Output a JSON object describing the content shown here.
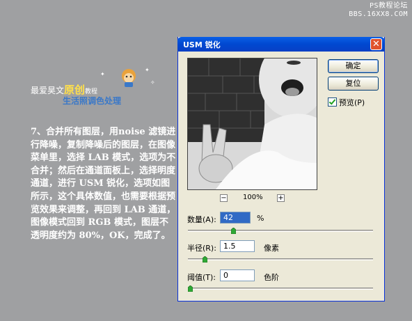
{
  "watermark": {
    "line1": "PS教程论坛",
    "line2": "BBS.16XX8.COM"
  },
  "banner": {
    "prefix": "最爱昊文",
    "highlight": "原创",
    "suffix": "教程",
    "subtitle": "生活照调色处理"
  },
  "article": {
    "text": "7、合并所有图层，用noise 滤镜进行降噪，复制降噪后的图层，在图像菜单里，选择 LAB 模式，选项为不合并；然后在通道面板上，选择明度通道，进行 USM 锐化，选项如图所示，这个具体数值，也需要根据预览效果来调整，再回到 LAB 通道，图像模式回到 RGB 模式，图层不透明度约为 80%，OK，完成了。"
  },
  "dialog": {
    "title": "USM 锐化",
    "ok_label": "确定",
    "reset_label": "复位",
    "preview_label": "预览(P)",
    "zoom_value": "100%",
    "zoom_out_label": "−",
    "zoom_in_label": "+",
    "amount": {
      "label": "数量(A):",
      "value": "42",
      "unit": "%",
      "slider_fraction": 0.24
    },
    "radius": {
      "label": "半径(R):",
      "value": "1.5",
      "unit": "像素",
      "slider_fraction": 0.08
    },
    "threshold": {
      "label": "阈值(T):",
      "value": "0",
      "unit": "色阶",
      "slider_fraction": 0.0
    }
  },
  "colors": {
    "titlebar": "#0048d0",
    "close": "#e0532d",
    "background": "#9fa0a2",
    "article_text": "#ffffff"
  }
}
